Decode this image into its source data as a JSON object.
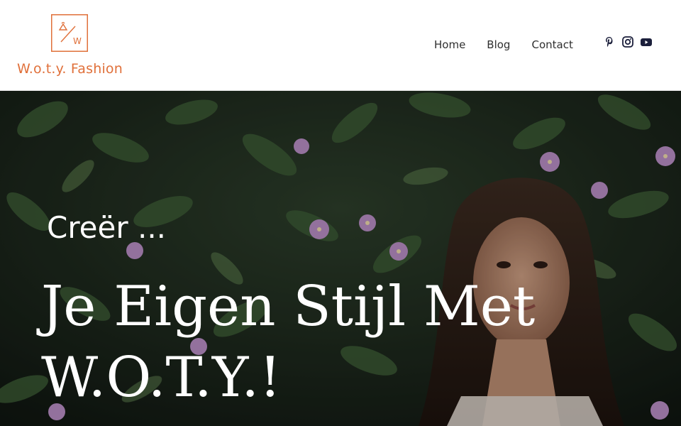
{
  "brand": {
    "name": "W.o.t.y. Fashion",
    "mark_letter": "W",
    "color": "#e0703a"
  },
  "nav": {
    "items": [
      {
        "label": "Home"
      },
      {
        "label": "Blog"
      },
      {
        "label": "Contact"
      }
    ]
  },
  "social": {
    "icons": [
      "pinterest-icon",
      "instagram-icon",
      "youtube-icon"
    ],
    "color": "#1b1f3b"
  },
  "hero": {
    "subtitle": "Creër ...",
    "title_line1": "Je Eigen Stijl Met",
    "title_line2": "W.O.T.Y.!"
  }
}
